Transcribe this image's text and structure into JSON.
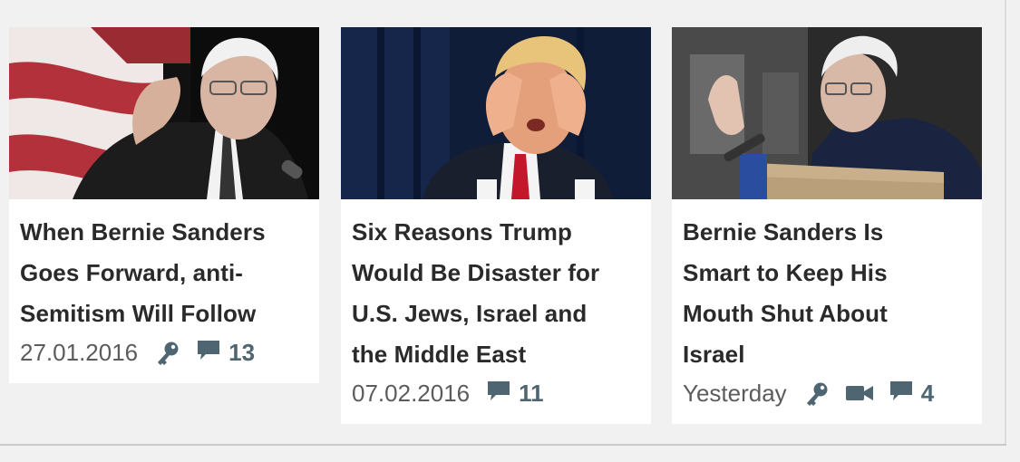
{
  "articles": [
    {
      "title": "When Bernie Sanders Goes Forward, anti-Semitism Will Follow",
      "title_lines": [
        "When Bernie Sanders",
        "Goes Forward, anti-",
        "Semitism Will Follow"
      ],
      "date": "27.01.2016",
      "icons": [
        "key-icon",
        "comment-icon"
      ],
      "comments": "13"
    },
    {
      "title": "Six Reasons Trump Would Be Disaster for U.S. Jews, Israel and the Middle East",
      "title_lines": [
        "Six Reasons Trump",
        "Would Be Disaster for",
        "U.S. Jews, Israel and",
        "the Middle East"
      ],
      "date": "07.02.2016",
      "icons": [
        "comment-icon"
      ],
      "comments": "11"
    },
    {
      "title": "Bernie Sanders Is Smart to Keep His Mouth Shut About Israel",
      "title_lines": [
        "Bernie Sanders Is",
        "Smart to Keep His",
        "Mouth Shut About",
        "Israel"
      ],
      "date": "Yesterday",
      "icons": [
        "key-icon",
        "video-icon",
        "comment-icon"
      ],
      "comments": "4"
    }
  ],
  "colors": {
    "page_background": "#f1f1f1",
    "card_background": "#ffffff",
    "title_text": "#2a2a2a",
    "date_text": "#5c5c5c",
    "icon_color": "#4f6672"
  }
}
